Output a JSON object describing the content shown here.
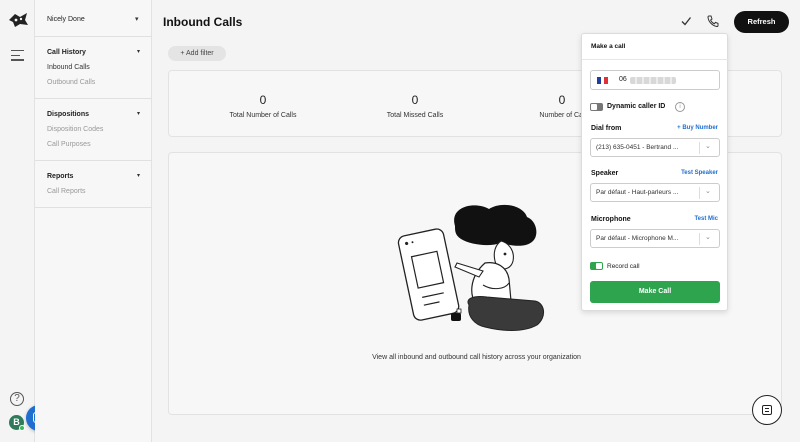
{
  "nav": {
    "org_name": "Nicely Done",
    "sections": [
      {
        "heading": "Call History",
        "items": [
          "Inbound Calls",
          "Outbound Calls"
        ]
      },
      {
        "heading": "Dispositions",
        "items": [
          "Disposition Codes",
          "Call Purposes"
        ]
      },
      {
        "heading": "Reports",
        "items": [
          "Call Reports"
        ]
      }
    ]
  },
  "rail": {
    "help_glyph": "?",
    "avatar_initial": "B"
  },
  "header": {
    "title": "Inbound Calls",
    "refresh_label": "Refresh"
  },
  "filter": {
    "label": "+ Add filter"
  },
  "stats": [
    {
      "value": "0",
      "label": "Total Number of Calls"
    },
    {
      "value": "0",
      "label": "Total Missed Calls"
    },
    {
      "value": "0",
      "label": "Number of Cal"
    }
  ],
  "empty_state": {
    "message": "View all inbound and outbound call history across your organization"
  },
  "make_call_panel": {
    "title": "Make a call",
    "phone_prefix": "06",
    "dynamic_caller_id_label": "Dynamic caller ID",
    "dynamic_caller_id_enabled": false,
    "info_glyph": "i",
    "dial_from": {
      "label": "Dial from",
      "link": "+ Buy Number",
      "value": "(213) 635-0451 - Bertrand ..."
    },
    "speaker": {
      "label": "Speaker",
      "link": "Test Speaker",
      "value": "Par défaut - Haut-parleurs ..."
    },
    "microphone": {
      "label": "Microphone",
      "link": "Test Mic",
      "value": "Par défaut - Microphone M..."
    },
    "record_call_label": "Record call",
    "record_call_enabled": true,
    "make_call_label": "Make Call"
  },
  "icons": {
    "logo": "brand-logo-icon",
    "menu": "hamburger-icon",
    "check": "check-icon",
    "phone": "phone-icon",
    "help": "help-icon",
    "chat": "chat-icon",
    "support": "support-chat-icon"
  },
  "colors": {
    "primary_button": "#111111",
    "accent_link": "#1f6fd1",
    "make_call": "#2ea44f",
    "toggle_on": "#2ea44f",
    "toggle_off": "#777777",
    "avatar": "#2f7a5a"
  }
}
